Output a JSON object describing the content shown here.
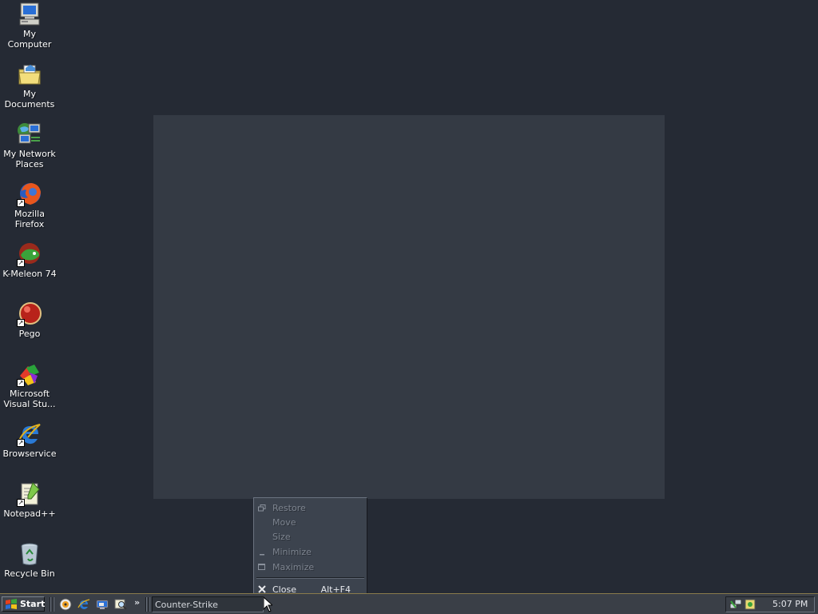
{
  "desktop": {
    "icons": [
      {
        "label": "My Computer",
        "icon": "computer-icon"
      },
      {
        "label": "My Documents",
        "icon": "documents-folder-icon"
      },
      {
        "label": "My Network Places",
        "icon": "network-places-icon"
      },
      {
        "label": "Mozilla Firefox",
        "icon": "firefox-icon"
      },
      {
        "label": "K-Meleon 74",
        "icon": "kmeleon-icon"
      },
      {
        "label": "Pego",
        "icon": "pego-icon"
      },
      {
        "label": "Microsoft Visual Stu...",
        "icon": "visual-studio-icon"
      },
      {
        "label": "Browservice",
        "icon": "ie-icon"
      },
      {
        "label": "Notepad++",
        "icon": "notepadpp-icon"
      },
      {
        "label": "Recycle Bin",
        "icon": "recycle-bin-icon"
      }
    ]
  },
  "context_menu": {
    "items": [
      {
        "label": "Restore",
        "enabled": false,
        "icon": "restore-icon"
      },
      {
        "label": "Move",
        "enabled": false
      },
      {
        "label": "Size",
        "enabled": false
      },
      {
        "label": "Minimize",
        "enabled": false,
        "icon": "minimize-icon"
      },
      {
        "label": "Maximize",
        "enabled": false,
        "icon": "maximize-icon"
      },
      {
        "label": "Close",
        "enabled": true,
        "icon": "close-icon",
        "shortcut": "Alt+F4"
      }
    ]
  },
  "taskbar": {
    "start_label": "Start",
    "quick_launch": [
      "media-player-icon",
      "ie-icon",
      "show-desktop-icon",
      "search-icon"
    ],
    "more_label": "»",
    "task_label": "Counter-Strike",
    "tray_icons": [
      "network-tray-icon",
      "volume-tray-icon"
    ],
    "clock": "5:07 PM"
  },
  "colors": {
    "desktop_bg": "#252a34",
    "game_window_bg": "#343a44",
    "taskbar_bg": "#3a3f47"
  }
}
